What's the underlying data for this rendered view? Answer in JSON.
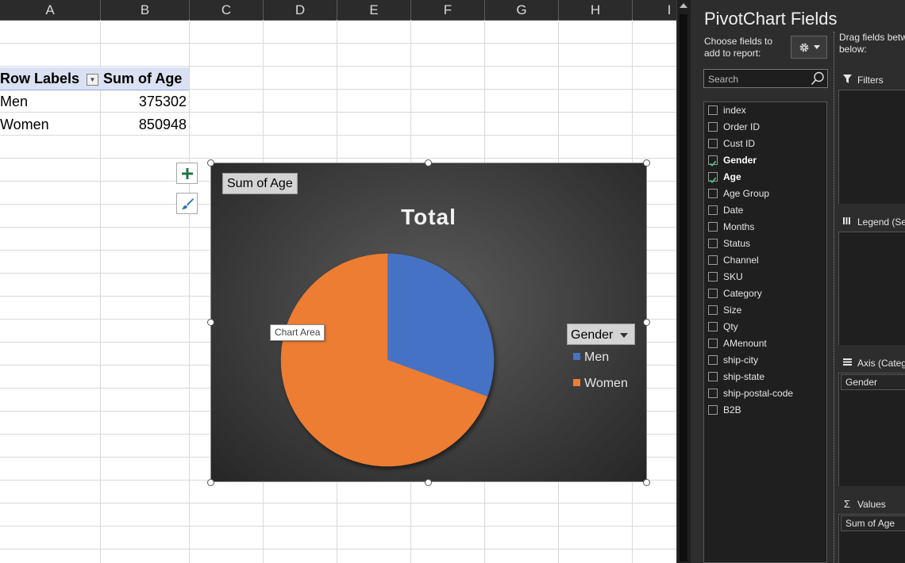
{
  "sheet": {
    "columns": [
      "A",
      "B",
      "C",
      "D",
      "E",
      "F",
      "G",
      "H",
      "I"
    ],
    "pivot": {
      "header_row_labels": "Row Labels",
      "header_sum": "Sum of Age",
      "rows": [
        {
          "label": "Men",
          "value": "375302"
        },
        {
          "label": "Women",
          "value": "850948"
        }
      ]
    },
    "side_buttons": [
      "chart-elements",
      "chart-styles"
    ]
  },
  "chart": {
    "field_button": "Sum of Age",
    "tooltip": "Chart Area",
    "legend_field_button": "Gender",
    "background": "#3f3f3f"
  },
  "chart_data": {
    "type": "pie",
    "title": "Total",
    "categories": [
      "Men",
      "Women"
    ],
    "values": [
      375302,
      850948
    ],
    "colors": [
      "#4472c4",
      "#ed7d31"
    ],
    "legend": "right"
  },
  "pane": {
    "title": "PivotChart Fields",
    "choose_label": "Choose fields to add to report:",
    "search_placeholder": "Search",
    "fields": [
      {
        "name": "index",
        "checked": false
      },
      {
        "name": "Order ID",
        "checked": false
      },
      {
        "name": "Cust ID",
        "checked": false
      },
      {
        "name": "Gender",
        "checked": true
      },
      {
        "name": "Age",
        "checked": true
      },
      {
        "name": "Age Group",
        "checked": false
      },
      {
        "name": "Date",
        "checked": false
      },
      {
        "name": "Months",
        "checked": false
      },
      {
        "name": "Status",
        "checked": false
      },
      {
        "name": "Channel",
        "checked": false
      },
      {
        "name": "SKU",
        "checked": false
      },
      {
        "name": "Category",
        "checked": false
      },
      {
        "name": "Size",
        "checked": false
      },
      {
        "name": "Qty",
        "checked": false
      },
      {
        "name": "AMenount",
        "checked": false
      },
      {
        "name": "ship-city",
        "checked": false
      },
      {
        "name": "ship-state",
        "checked": false
      },
      {
        "name": "ship-postal-code",
        "checked": false
      },
      {
        "name": "B2B",
        "checked": false
      }
    ],
    "drag_label": "Drag fields betw\nbelow:",
    "areas": {
      "filters": {
        "label": "Filters",
        "items": []
      },
      "legend": {
        "label": "Legend (Ser",
        "items": []
      },
      "axis": {
        "label": "Axis (Categ",
        "items": [
          "Gender"
        ]
      },
      "values": {
        "label": "Values",
        "items": [
          "Sum of Age"
        ]
      }
    }
  }
}
